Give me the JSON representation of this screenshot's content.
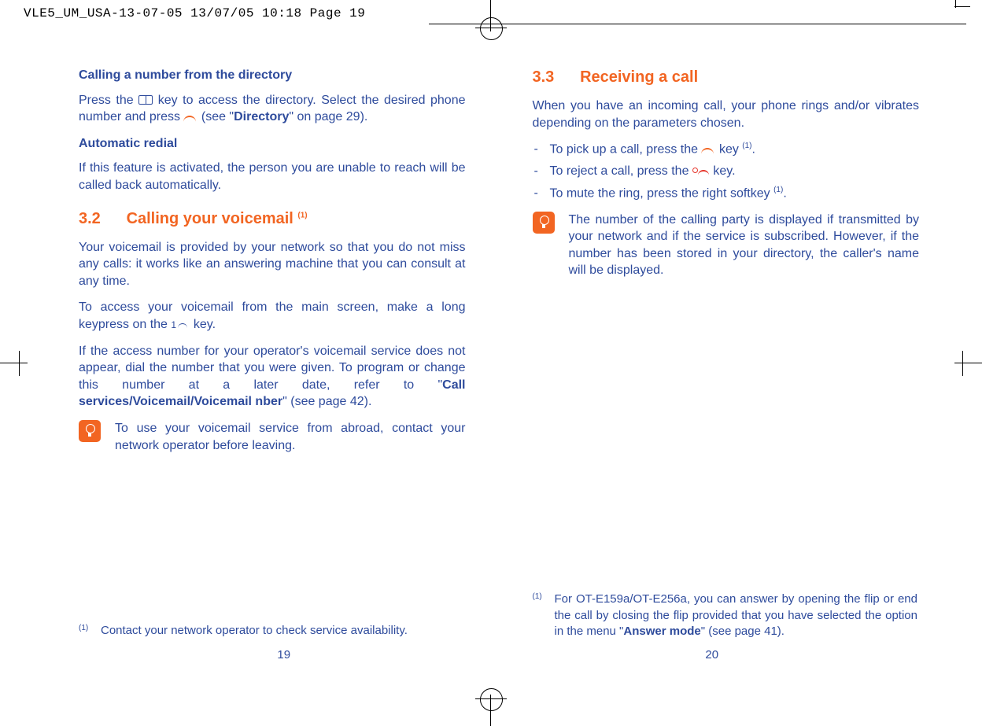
{
  "print": {
    "slug": "VLE5_UM_USA-13-07-05  13/07/05  10:18  Page 19"
  },
  "left": {
    "h_calldir": "Calling a number from the directory",
    "p_calldir_a": "Press the ",
    "p_calldir_b": " key to access the directory. Select the desired phone number and press ",
    "p_calldir_c": " (see \"",
    "p_calldir_bold": "Directory",
    "p_calldir_d": "\" on page 29).",
    "h_auto": "Automatic redial",
    "p_auto": "If this feature is activated, the person you are unable to reach will be called back automatically.",
    "sec32_num": "3.2",
    "sec32_title": "Calling your voicemail ",
    "sec32_sup": "(1)",
    "p_vm1": "Your voicemail is provided by your network so that you do not miss any calls: it works like an answering machine that you can consult at any time.",
    "p_vm2_a": "To access your voicemail from the main screen, make a long keypress on the ",
    "p_vm2_b": " key.",
    "p_vm3_a": "If the access number for your operator's voicemail service does not appear, dial the number that you were given. To program or change this number at a later date, refer to \"",
    "p_vm3_bold": "Call services/Voicemail/Voicemail nber",
    "p_vm3_b": "\" (see page 42).",
    "tip": "To use your voicemail service from abroad, contact your network operator before leaving.",
    "footnote_marker": "(1)",
    "footnote": "Contact your network operator to check service availability.",
    "pagenum": "19"
  },
  "right": {
    "sec33_num": "3.3",
    "sec33_title": "Receiving a call",
    "p_intro": "When you have an incoming call, your phone rings and/or vibrates depending on the parameters chosen.",
    "li1_a": "To pick up a call, press the ",
    "li1_b": " key ",
    "li1_sup": "(1)",
    "li1_c": ".",
    "li2_a": "To reject a call, press the ",
    "li2_b": " key.",
    "li3_a": "To mute the ring, press the right softkey ",
    "li3_sup": "(1)",
    "li3_b": ".",
    "tip": "The number of the calling party is displayed if transmitted by your network and if the service is subscribed. However, if the number has been stored in your directory, the caller's name will be displayed.",
    "footnote_marker": "(1)",
    "footnote_a": "For OT-E159a/OT-E256a, you can answer by opening the flip or end the call by closing the flip provided that you have selected the option in the menu \"",
    "footnote_bold": "Answer mode",
    "footnote_b": "\" (see page 41).",
    "pagenum": "20"
  }
}
